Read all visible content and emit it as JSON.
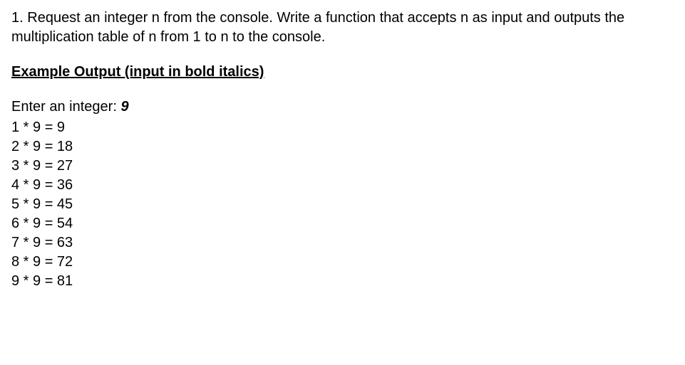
{
  "question": {
    "number": "1.",
    "text": "Request an integer n from the console. Write a function that accepts n as input and outputs the multiplication table of n from 1 to n to the console."
  },
  "exampleHeading": "Example Output (input in bold italics)",
  "prompt": {
    "label": "Enter an integer: ",
    "input": "9"
  },
  "outputLines": [
    "1 * 9 = 9",
    "2 * 9 = 18",
    "3 * 9 = 27",
    "4 * 9 = 36",
    "5 * 9 = 45",
    "6 * 9 = 54",
    "7 * 9 = 63",
    "8 * 9 = 72",
    "9 * 9 = 81"
  ]
}
